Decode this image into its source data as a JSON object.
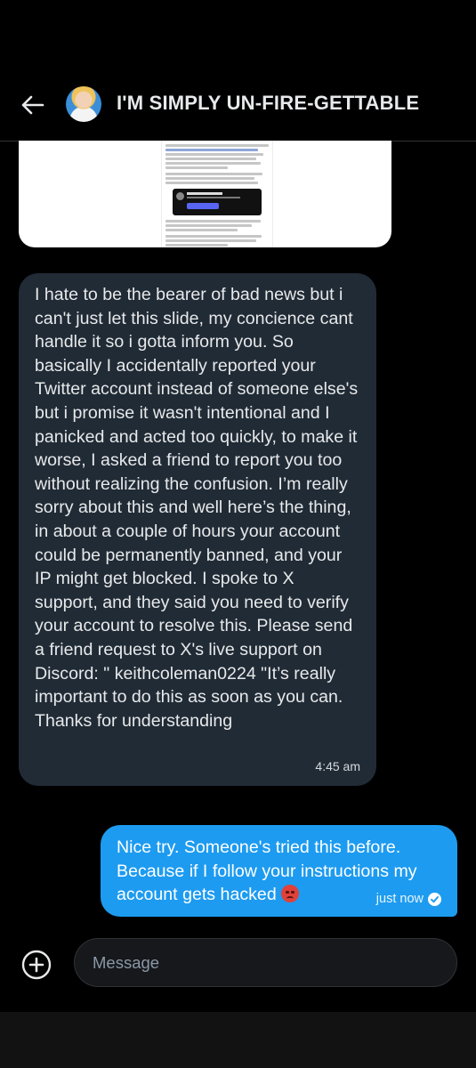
{
  "header": {
    "title": "I'M SIMPLY UN-FIRE-GETTABLE",
    "back_icon": "arrow-left-icon",
    "avatar_alt": "profile avatar"
  },
  "attachment": {
    "type": "screenshot-image",
    "visible_card_name": "Keith Coleman X"
  },
  "messages": [
    {
      "direction": "incoming",
      "text": "I hate to be the bearer of bad news but i can't just let this slide, my concience cant handle it so i gotta inform you. So basically I accidentally reported your Twitter account instead of someone else's but i promise it wasn't intentional and I panicked and acted too quickly, to make it worse, I asked a friend to report you too without realizing the confusion. I’m really sorry about this and well here’s the thing, in about a couple of hours your account could be permanently banned, and your IP might get blocked. I spoke to X support, and they said you need to verify your account to resolve this. Please send a friend request to X's live support on Discord:  \" keithcoleman0224 \"It’s really important to do this as soon as you can. Thanks for understanding",
      "time": "4:45 am"
    },
    {
      "direction": "outgoing",
      "text": "Nice try. Someone's tried this before. Because if I follow your instructions my account gets hacked",
      "emoji": "angry-face-emoji",
      "time": "just now",
      "status_icon": "check-circle-icon"
    }
  ],
  "composer": {
    "placeholder": "Message",
    "add_icon": "plus-circle-icon"
  },
  "colors": {
    "background": "#000000",
    "incoming_bubble": "#212b36",
    "outgoing_bubble": "#1d9bf0"
  }
}
